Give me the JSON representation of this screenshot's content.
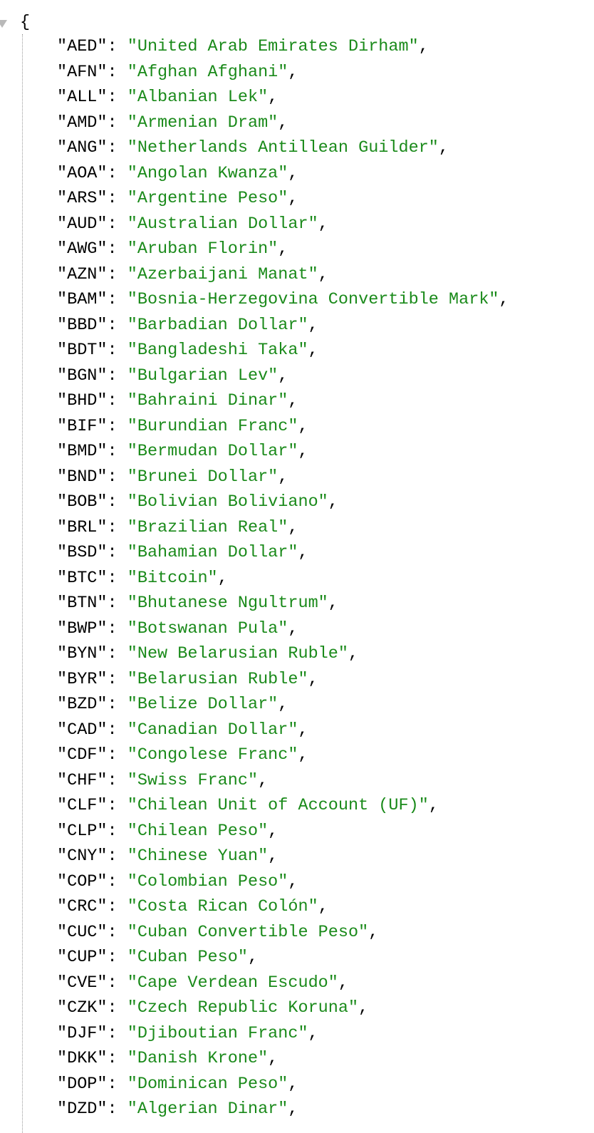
{
  "json_viewer": {
    "open_brace": "{",
    "entries": [
      {
        "key": "\"AED\"",
        "value": "\"United Arab Emirates Dirham\""
      },
      {
        "key": "\"AFN\"",
        "value": "\"Afghan Afghani\""
      },
      {
        "key": "\"ALL\"",
        "value": "\"Albanian Lek\""
      },
      {
        "key": "\"AMD\"",
        "value": "\"Armenian Dram\""
      },
      {
        "key": "\"ANG\"",
        "value": "\"Netherlands Antillean Guilder\""
      },
      {
        "key": "\"AOA\"",
        "value": "\"Angolan Kwanza\""
      },
      {
        "key": "\"ARS\"",
        "value": "\"Argentine Peso\""
      },
      {
        "key": "\"AUD\"",
        "value": "\"Australian Dollar\""
      },
      {
        "key": "\"AWG\"",
        "value": "\"Aruban Florin\""
      },
      {
        "key": "\"AZN\"",
        "value": "\"Azerbaijani Manat\""
      },
      {
        "key": "\"BAM\"",
        "value": "\"Bosnia-Herzegovina Convertible Mark\""
      },
      {
        "key": "\"BBD\"",
        "value": "\"Barbadian Dollar\""
      },
      {
        "key": "\"BDT\"",
        "value": "\"Bangladeshi Taka\""
      },
      {
        "key": "\"BGN\"",
        "value": "\"Bulgarian Lev\""
      },
      {
        "key": "\"BHD\"",
        "value": "\"Bahraini Dinar\""
      },
      {
        "key": "\"BIF\"",
        "value": "\"Burundian Franc\""
      },
      {
        "key": "\"BMD\"",
        "value": "\"Bermudan Dollar\""
      },
      {
        "key": "\"BND\"",
        "value": "\"Brunei Dollar\""
      },
      {
        "key": "\"BOB\"",
        "value": "\"Bolivian Boliviano\""
      },
      {
        "key": "\"BRL\"",
        "value": "\"Brazilian Real\""
      },
      {
        "key": "\"BSD\"",
        "value": "\"Bahamian Dollar\""
      },
      {
        "key": "\"BTC\"",
        "value": "\"Bitcoin\""
      },
      {
        "key": "\"BTN\"",
        "value": "\"Bhutanese Ngultrum\""
      },
      {
        "key": "\"BWP\"",
        "value": "\"Botswanan Pula\""
      },
      {
        "key": "\"BYN\"",
        "value": "\"New Belarusian Ruble\""
      },
      {
        "key": "\"BYR\"",
        "value": "\"Belarusian Ruble\""
      },
      {
        "key": "\"BZD\"",
        "value": "\"Belize Dollar\""
      },
      {
        "key": "\"CAD\"",
        "value": "\"Canadian Dollar\""
      },
      {
        "key": "\"CDF\"",
        "value": "\"Congolese Franc\""
      },
      {
        "key": "\"CHF\"",
        "value": "\"Swiss Franc\""
      },
      {
        "key": "\"CLF\"",
        "value": "\"Chilean Unit of Account (UF)\""
      },
      {
        "key": "\"CLP\"",
        "value": "\"Chilean Peso\""
      },
      {
        "key": "\"CNY\"",
        "value": "\"Chinese Yuan\""
      },
      {
        "key": "\"COP\"",
        "value": "\"Colombian Peso\""
      },
      {
        "key": "\"CRC\"",
        "value": "\"Costa Rican Colón\""
      },
      {
        "key": "\"CUC\"",
        "value": "\"Cuban Convertible Peso\""
      },
      {
        "key": "\"CUP\"",
        "value": "\"Cuban Peso\""
      },
      {
        "key": "\"CVE\"",
        "value": "\"Cape Verdean Escudo\""
      },
      {
        "key": "\"CZK\"",
        "value": "\"Czech Republic Koruna\""
      },
      {
        "key": "\"DJF\"",
        "value": "\"Djiboutian Franc\""
      },
      {
        "key": "\"DKK\"",
        "value": "\"Danish Krone\""
      },
      {
        "key": "\"DOP\"",
        "value": "\"Dominican Peso\""
      },
      {
        "key": "\"DZD\"",
        "value": "\"Algerian Dinar\""
      }
    ],
    "separator": ": ",
    "comma": ","
  },
  "colors": {
    "key": "#000000",
    "value": "#1a8a1a",
    "toggle": "#b9b9b9"
  },
  "icons": {
    "collapse_toggle": "triangle-down-icon"
  }
}
